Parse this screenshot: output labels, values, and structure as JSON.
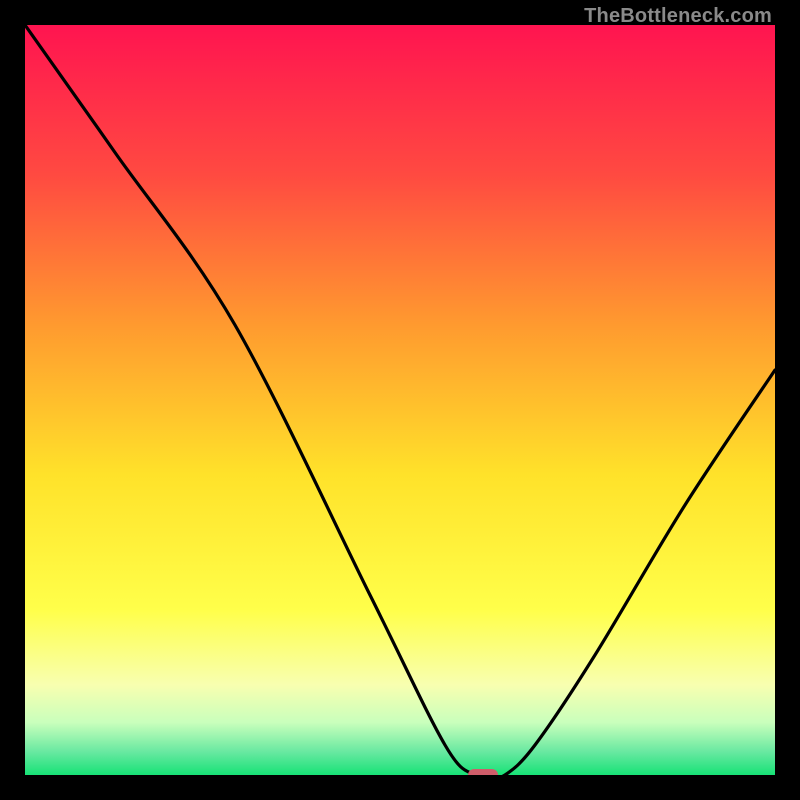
{
  "watermark": "TheBottleneck.com",
  "chart_data": {
    "type": "line",
    "title": "",
    "xlabel": "",
    "ylabel": "",
    "xlim": [
      0,
      100
    ],
    "ylim": [
      0,
      100
    ],
    "grid": false,
    "series": [
      {
        "name": "bottleneck-curve",
        "x": [
          0,
          12,
          28,
          46,
          56,
          60,
          62,
          64,
          68,
          76,
          88,
          100
        ],
        "y": [
          100,
          83,
          60,
          24,
          4,
          0,
          0,
          0,
          4,
          16,
          36,
          54
        ]
      }
    ],
    "marker": {
      "x": 61,
      "y": 0,
      "color": "#cf5d6a"
    },
    "background_gradient": {
      "stops": [
        {
          "pos": 0.0,
          "color": "#ff1450"
        },
        {
          "pos": 0.2,
          "color": "#ff4a41"
        },
        {
          "pos": 0.4,
          "color": "#ff9a2f"
        },
        {
          "pos": 0.6,
          "color": "#ffe22a"
        },
        {
          "pos": 0.78,
          "color": "#ffff4a"
        },
        {
          "pos": 0.88,
          "color": "#f8ffb0"
        },
        {
          "pos": 0.93,
          "color": "#c9ffbc"
        },
        {
          "pos": 0.97,
          "color": "#66e8a0"
        },
        {
          "pos": 1.0,
          "color": "#17e276"
        }
      ]
    }
  }
}
